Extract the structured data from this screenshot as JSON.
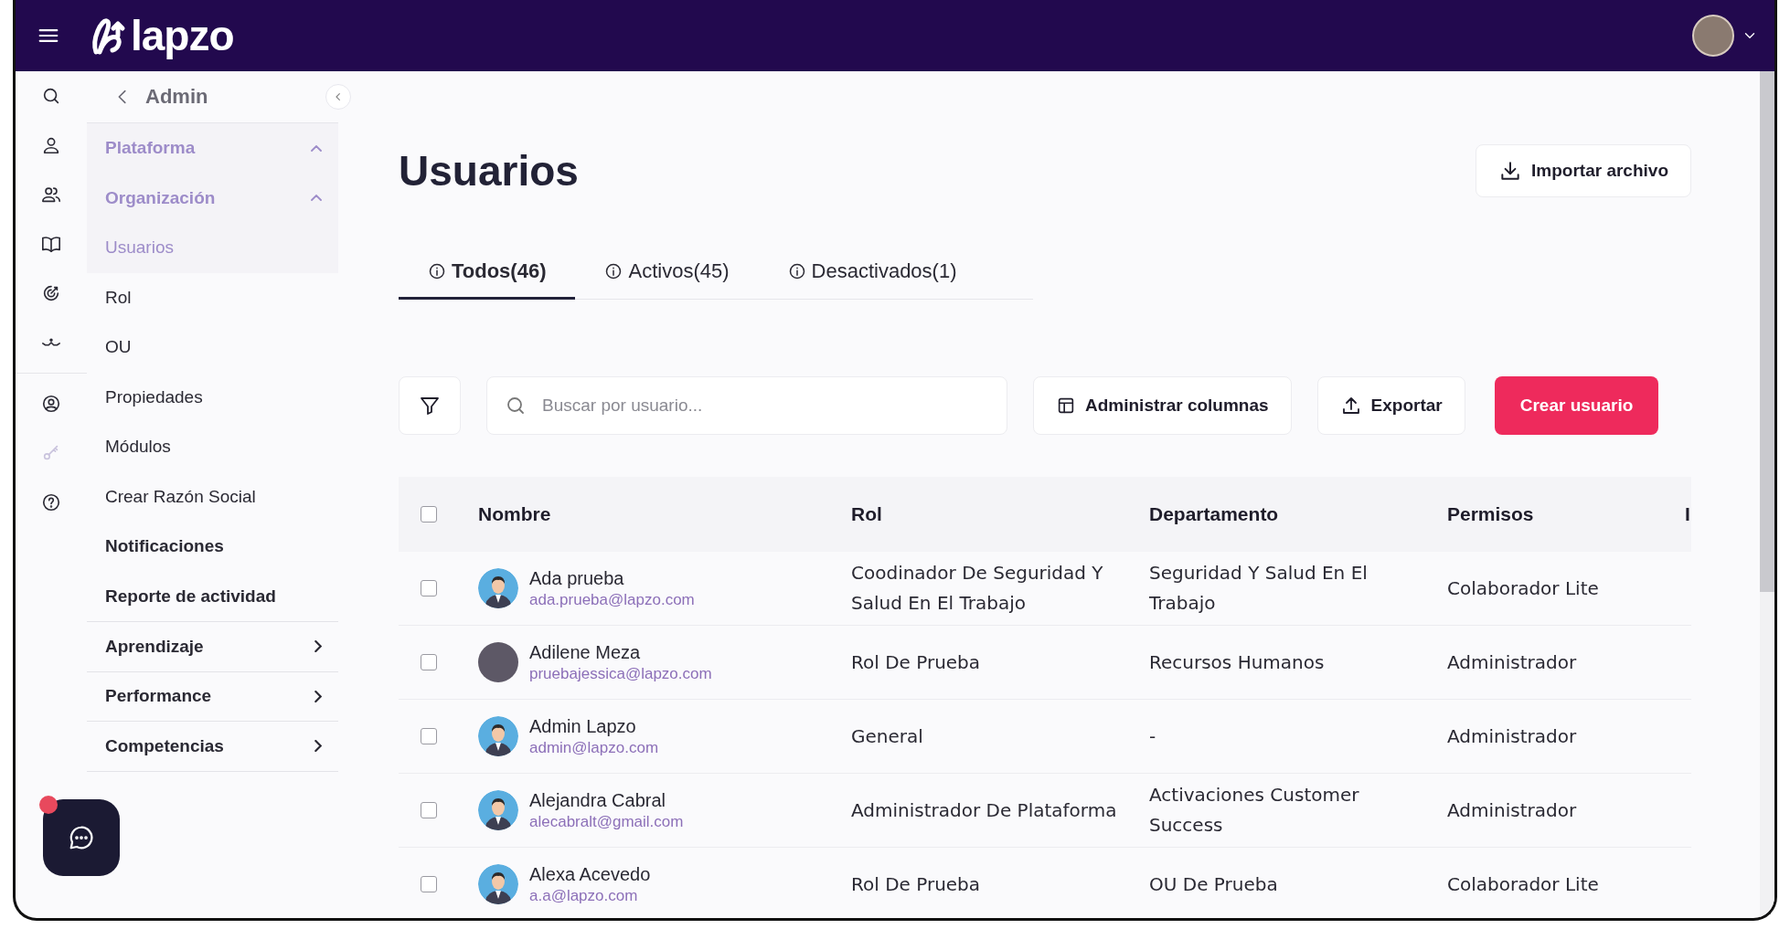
{
  "header": {
    "brand": "lapzo"
  },
  "sidebar": {
    "back_label": "Admin",
    "items": [
      {
        "label": "Plataforma",
        "kind": "group",
        "expanded": true,
        "bold": true,
        "dimmed": true
      },
      {
        "label": "Organización",
        "kind": "group",
        "expanded": true,
        "bold": true,
        "dimmed": true
      },
      {
        "label": "Usuarios",
        "kind": "link",
        "bold": false,
        "dimmed": true
      },
      {
        "label": "Rol",
        "kind": "link",
        "bold": false,
        "dimmed": false
      },
      {
        "label": "OU",
        "kind": "link",
        "bold": false,
        "dimmed": false
      },
      {
        "label": "Propiedades",
        "kind": "link",
        "bold": false,
        "dimmed": false
      },
      {
        "label": "Módulos",
        "kind": "link",
        "bold": false,
        "dimmed": false
      },
      {
        "label": "Crear Razón Social",
        "kind": "link",
        "bold": false,
        "dimmed": false
      },
      {
        "label": "Notificaciones",
        "kind": "link",
        "bold": true,
        "dimmed": false
      },
      {
        "label": "Reporte de actividad",
        "kind": "link",
        "bold": true,
        "dimmed": false
      },
      {
        "label": "Aprendizaje",
        "kind": "group",
        "expanded": false,
        "bold": true,
        "dimmed": false
      },
      {
        "label": "Performance",
        "kind": "group",
        "expanded": false,
        "bold": true,
        "dimmed": false
      },
      {
        "label": "Competencias",
        "kind": "group",
        "expanded": false,
        "bold": true,
        "dimmed": false
      }
    ]
  },
  "page": {
    "title": "Usuarios",
    "import_button": "Importar archivo"
  },
  "tabs": [
    {
      "label": "Todos(46)",
      "selected": true
    },
    {
      "label": "Activos(45)",
      "selected": false
    },
    {
      "label": "Desactivados(1)",
      "selected": false
    }
  ],
  "toolbar": {
    "search": {
      "placeholder": "Buscar por usuario..."
    },
    "columns_button": "Administrar columnas",
    "export_button": "Exportar",
    "create_button": "Crear usuario"
  },
  "table": {
    "select_all": {
      "checked": false
    },
    "columns": [
      "Nombre",
      "Rol",
      "Departamento",
      "Permisos",
      "I"
    ],
    "rows": [
      {
        "checked": false,
        "photo": false,
        "name": "Ada prueba",
        "email": "ada.prueba@lapzo.com",
        "role": "Coodinador De Seguridad Y Salud En El Trabajo",
        "department": "Seguridad Y Salud En El Trabajo",
        "permissions": "Colaborador Lite"
      },
      {
        "checked": false,
        "photo": true,
        "name": "Adilene Meza",
        "email": "pruebajessica@lapzo.com",
        "role": "Rol De Prueba",
        "department": "Recursos Humanos",
        "permissions": "Administrador"
      },
      {
        "checked": false,
        "photo": false,
        "name": "Admin Lapzo",
        "email": "admin@lapzo.com",
        "role": "General",
        "department": "-",
        "permissions": "Administrador"
      },
      {
        "checked": false,
        "photo": false,
        "name": "Alejandra Cabral",
        "email": "alecabralt@gmail.com",
        "role": "Administrador De Plataforma",
        "department": "Activaciones Customer Success",
        "permissions": "Administrador"
      },
      {
        "checked": false,
        "photo": false,
        "name": "Alexa Acevedo",
        "email": "a.a@lapzo.com",
        "role": "Rol De Prueba",
        "department": "OU De Prueba",
        "permissions": "Colaborador Lite"
      }
    ]
  }
}
